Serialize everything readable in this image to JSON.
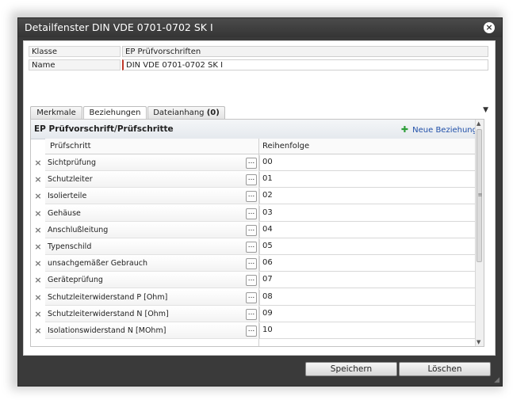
{
  "window": {
    "title": "Detailfenster DIN VDE 0701-0702 SK I",
    "close_glyph": "×"
  },
  "fields": [
    {
      "label": "Klasse",
      "value": "EP Prüfvorschriften"
    },
    {
      "label": "Name",
      "value": "DIN VDE 0701-0702 SK I"
    }
  ],
  "tabs": {
    "merkmale": "Merkmale",
    "beziehungen": "Beziehungen",
    "dateianhang": "Dateianhang",
    "dateianhang_count": "(0)",
    "overflow_glyph": "▼",
    "active": "Beziehungen"
  },
  "panel": {
    "title": "EP Prüfvorschrift/Prüfschritte",
    "new_relation": "Neue Beziehung",
    "columns": {
      "step": "Prüfschritt",
      "order": "Reihenfolge"
    },
    "rows": [
      {
        "step": "Sichtprüfung",
        "order": "00"
      },
      {
        "step": "Schutzleiter",
        "order": "01"
      },
      {
        "step": "Isolierteile",
        "order": "02"
      },
      {
        "step": "Gehäuse",
        "order": "03"
      },
      {
        "step": "Anschlußleitung",
        "order": "04"
      },
      {
        "step": "Typenschild",
        "order": "05"
      },
      {
        "step": "unsachgemäßer Gebrauch",
        "order": "06"
      },
      {
        "step": "Geräteprüfung",
        "order": "07"
      },
      {
        "step": "Schutzleiterwiderstand P [Ohm]",
        "order": "08"
      },
      {
        "step": "Schutzleiterwiderstand N [Ohm]",
        "order": "09"
      },
      {
        "step": "Isolationswiderstand N [MOhm]",
        "order": "10"
      }
    ],
    "row_delete_glyph": "×",
    "row_browse_glyph": "..."
  },
  "buttons": {
    "save": "Speichern",
    "delete": "Löschen"
  },
  "colors": {
    "accent_link": "#1f4fa8",
    "plus_green": "#2e9e3a",
    "required_marker": "#c0392b"
  }
}
